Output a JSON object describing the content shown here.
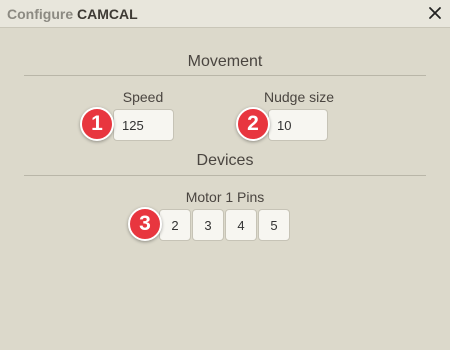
{
  "window": {
    "title_prefix": "Configure",
    "title_name": "CAMCAL"
  },
  "icons": {
    "close": "close-icon"
  },
  "colors": {
    "badge": "#e8363f",
    "background": "#dcd9cb"
  },
  "movement": {
    "heading": "Movement",
    "speed": {
      "label": "Speed",
      "value": "125"
    },
    "nudge": {
      "label": "Nudge size",
      "value": "10"
    }
  },
  "devices": {
    "heading": "Devices",
    "motor_label": "Motor 1 Pins",
    "pins": [
      "2",
      "3",
      "4",
      "5"
    ]
  },
  "badges": [
    "1",
    "2",
    "3"
  ]
}
